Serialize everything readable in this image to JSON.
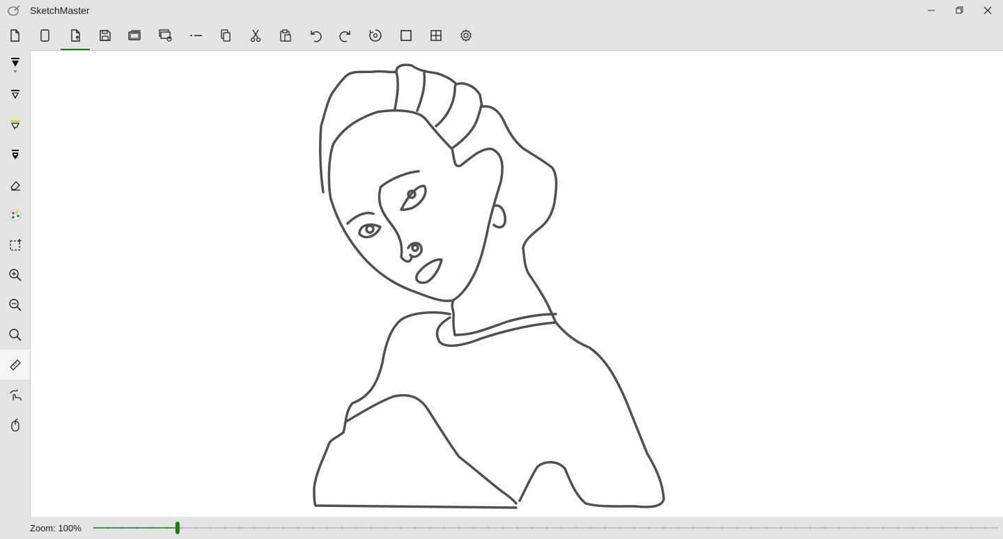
{
  "window": {
    "title": "SketchMaster"
  },
  "toolbar": {
    "items": [
      {
        "icon": "new-page-icon",
        "label": "New"
      },
      {
        "icon": "blank-page-icon",
        "label": "Blank page"
      },
      {
        "icon": "open-file-icon",
        "label": "Open",
        "active": true
      },
      {
        "icon": "save-icon",
        "label": "Save"
      },
      {
        "icon": "save-as-icon",
        "label": "Save as"
      },
      {
        "icon": "export-icon",
        "label": "Export"
      },
      {
        "icon": "dash-line-icon",
        "label": "Line style"
      },
      {
        "icon": "copy-icon",
        "label": "Copy"
      },
      {
        "icon": "cut-icon",
        "label": "Cut"
      },
      {
        "icon": "paste-icon",
        "label": "Paste"
      },
      {
        "icon": "undo-icon",
        "label": "Undo"
      },
      {
        "icon": "redo-icon",
        "label": "Redo"
      },
      {
        "icon": "rotate-icon",
        "label": "Rotate"
      },
      {
        "icon": "square-icon",
        "label": "Canvas frame"
      },
      {
        "icon": "grid-icon",
        "label": "Grid"
      },
      {
        "icon": "settings-icon",
        "label": "Settings"
      }
    ]
  },
  "sidebar": {
    "tools": [
      {
        "icon": "pen-dropdown-icon",
        "label": "Pen"
      },
      {
        "icon": "pencil-icon",
        "label": "Pencil"
      },
      {
        "icon": "highlighter-icon",
        "label": "Highlighter"
      },
      {
        "icon": "marker-icon",
        "label": "Marker"
      },
      {
        "icon": "eraser-icon",
        "label": "Eraser"
      },
      {
        "icon": "color-palette-icon",
        "label": "Colors"
      },
      {
        "icon": "lasso-select-icon",
        "label": "Select"
      },
      {
        "icon": "zoom-in-icon",
        "label": "Zoom in"
      },
      {
        "icon": "zoom-out-icon",
        "label": "Zoom out"
      },
      {
        "icon": "zoom-reset-icon",
        "label": "Reset zoom"
      },
      {
        "icon": "ruler-icon",
        "label": "Ruler",
        "selected": true
      },
      {
        "icon": "touch-draw-icon",
        "label": "Touch drawing"
      },
      {
        "icon": "mouse-icon",
        "label": "Mouse input"
      }
    ]
  },
  "status": {
    "zoom_label": "Zoom: 100%",
    "zoom_fraction": 0.093
  },
  "colors": {
    "accent": "#1d7a1d",
    "stroke": "#505050",
    "chrome": "#e4e4e4",
    "canvas": "#ffffff"
  }
}
